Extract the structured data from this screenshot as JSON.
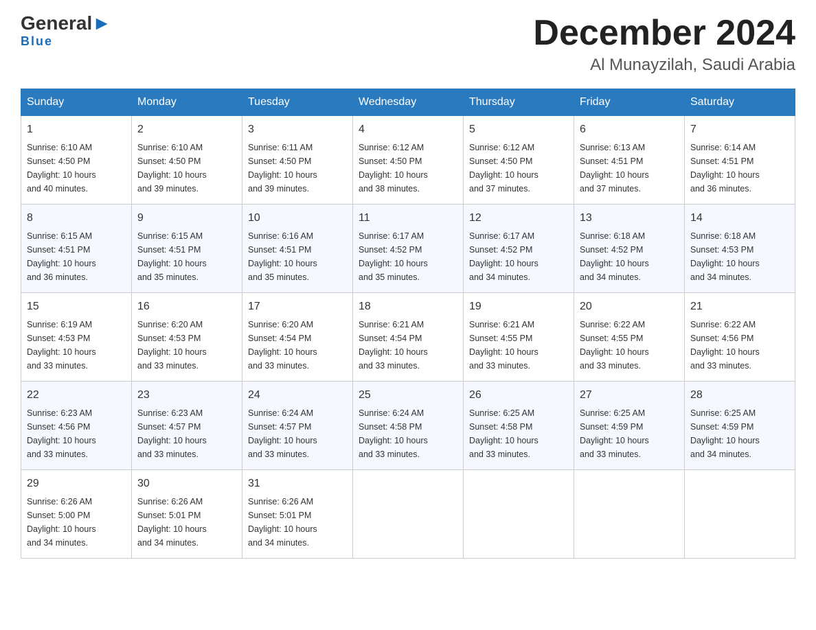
{
  "logo": {
    "brand": "General",
    "brand_blue": "Blue"
  },
  "header": {
    "month": "December 2024",
    "location": "Al Munayzilah, Saudi Arabia"
  },
  "days_of_week": [
    "Sunday",
    "Monday",
    "Tuesday",
    "Wednesday",
    "Thursday",
    "Friday",
    "Saturday"
  ],
  "weeks": [
    [
      {
        "day": "1",
        "sunrise": "6:10 AM",
        "sunset": "4:50 PM",
        "daylight": "10 hours and 40 minutes."
      },
      {
        "day": "2",
        "sunrise": "6:10 AM",
        "sunset": "4:50 PM",
        "daylight": "10 hours and 39 minutes."
      },
      {
        "day": "3",
        "sunrise": "6:11 AM",
        "sunset": "4:50 PM",
        "daylight": "10 hours and 39 minutes."
      },
      {
        "day": "4",
        "sunrise": "6:12 AM",
        "sunset": "4:50 PM",
        "daylight": "10 hours and 38 minutes."
      },
      {
        "day": "5",
        "sunrise": "6:12 AM",
        "sunset": "4:50 PM",
        "daylight": "10 hours and 37 minutes."
      },
      {
        "day": "6",
        "sunrise": "6:13 AM",
        "sunset": "4:51 PM",
        "daylight": "10 hours and 37 minutes."
      },
      {
        "day": "7",
        "sunrise": "6:14 AM",
        "sunset": "4:51 PM",
        "daylight": "10 hours and 36 minutes."
      }
    ],
    [
      {
        "day": "8",
        "sunrise": "6:15 AM",
        "sunset": "4:51 PM",
        "daylight": "10 hours and 36 minutes."
      },
      {
        "day": "9",
        "sunrise": "6:15 AM",
        "sunset": "4:51 PM",
        "daylight": "10 hours and 35 minutes."
      },
      {
        "day": "10",
        "sunrise": "6:16 AM",
        "sunset": "4:51 PM",
        "daylight": "10 hours and 35 minutes."
      },
      {
        "day": "11",
        "sunrise": "6:17 AM",
        "sunset": "4:52 PM",
        "daylight": "10 hours and 35 minutes."
      },
      {
        "day": "12",
        "sunrise": "6:17 AM",
        "sunset": "4:52 PM",
        "daylight": "10 hours and 34 minutes."
      },
      {
        "day": "13",
        "sunrise": "6:18 AM",
        "sunset": "4:52 PM",
        "daylight": "10 hours and 34 minutes."
      },
      {
        "day": "14",
        "sunrise": "6:18 AM",
        "sunset": "4:53 PM",
        "daylight": "10 hours and 34 minutes."
      }
    ],
    [
      {
        "day": "15",
        "sunrise": "6:19 AM",
        "sunset": "4:53 PM",
        "daylight": "10 hours and 33 minutes."
      },
      {
        "day": "16",
        "sunrise": "6:20 AM",
        "sunset": "4:53 PM",
        "daylight": "10 hours and 33 minutes."
      },
      {
        "day": "17",
        "sunrise": "6:20 AM",
        "sunset": "4:54 PM",
        "daylight": "10 hours and 33 minutes."
      },
      {
        "day": "18",
        "sunrise": "6:21 AM",
        "sunset": "4:54 PM",
        "daylight": "10 hours and 33 minutes."
      },
      {
        "day": "19",
        "sunrise": "6:21 AM",
        "sunset": "4:55 PM",
        "daylight": "10 hours and 33 minutes."
      },
      {
        "day": "20",
        "sunrise": "6:22 AM",
        "sunset": "4:55 PM",
        "daylight": "10 hours and 33 minutes."
      },
      {
        "day": "21",
        "sunrise": "6:22 AM",
        "sunset": "4:56 PM",
        "daylight": "10 hours and 33 minutes."
      }
    ],
    [
      {
        "day": "22",
        "sunrise": "6:23 AM",
        "sunset": "4:56 PM",
        "daylight": "10 hours and 33 minutes."
      },
      {
        "day": "23",
        "sunrise": "6:23 AM",
        "sunset": "4:57 PM",
        "daylight": "10 hours and 33 minutes."
      },
      {
        "day": "24",
        "sunrise": "6:24 AM",
        "sunset": "4:57 PM",
        "daylight": "10 hours and 33 minutes."
      },
      {
        "day": "25",
        "sunrise": "6:24 AM",
        "sunset": "4:58 PM",
        "daylight": "10 hours and 33 minutes."
      },
      {
        "day": "26",
        "sunrise": "6:25 AM",
        "sunset": "4:58 PM",
        "daylight": "10 hours and 33 minutes."
      },
      {
        "day": "27",
        "sunrise": "6:25 AM",
        "sunset": "4:59 PM",
        "daylight": "10 hours and 33 minutes."
      },
      {
        "day": "28",
        "sunrise": "6:25 AM",
        "sunset": "4:59 PM",
        "daylight": "10 hours and 34 minutes."
      }
    ],
    [
      {
        "day": "29",
        "sunrise": "6:26 AM",
        "sunset": "5:00 PM",
        "daylight": "10 hours and 34 minutes."
      },
      {
        "day": "30",
        "sunrise": "6:26 AM",
        "sunset": "5:01 PM",
        "daylight": "10 hours and 34 minutes."
      },
      {
        "day": "31",
        "sunrise": "6:26 AM",
        "sunset": "5:01 PM",
        "daylight": "10 hours and 34 minutes."
      },
      null,
      null,
      null,
      null
    ]
  ],
  "labels": {
    "sunrise": "Sunrise:",
    "sunset": "Sunset:",
    "daylight": "Daylight:"
  }
}
